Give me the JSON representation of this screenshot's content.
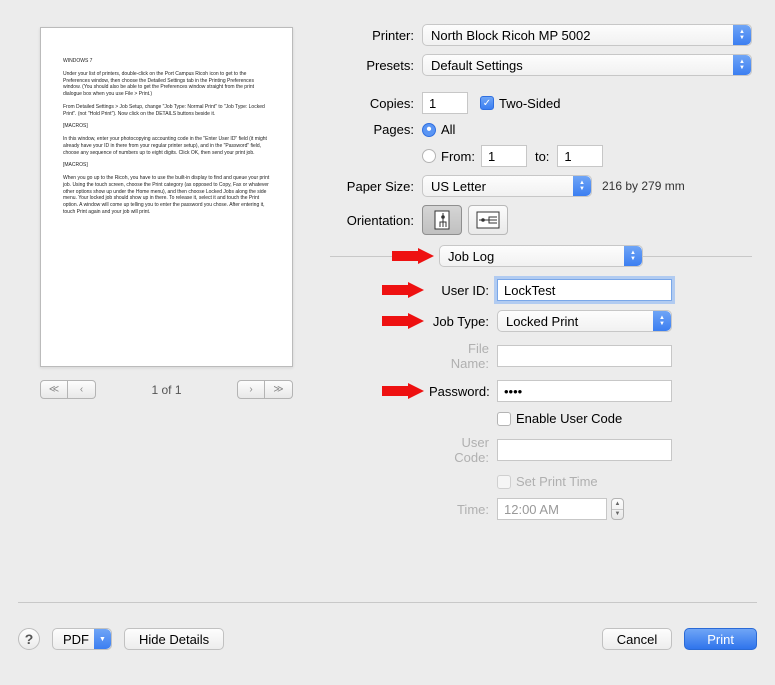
{
  "preview": {
    "page_indicator": "1 of 1",
    "doc": {
      "p1": "WINDOWS 7",
      "p2": "Under your list of printers, double-click on the Port Campus Ricoh icon to get to the Preferences window, then choose the Detailed Settings tab in the Printing Preferences window. (You should also be able to get the Preferences window straight from the print dialogue box when you use File > Print.)",
      "p3": "From Detailed Settings > Job Setup, change \"Job Type: Normal Print\" to \"Job Type: Locked Print\". (not \"Hold Print\"). Now click on the DETAILS buttons beside it.",
      "p4": "[MACROS]",
      "p5": "In this window, enter your photocopying accounting code in the \"Enter User ID\" field (it might already have your ID in there from your regular printer setup), and in the \"Password\" field, choose any sequence of numbers up to eight digits. Click OK, then send your print job.",
      "p6": "[MACROS]",
      "p7": "When you go up to the Ricoh, you have to use the built-in display to find and queue your print job. Using the touch screen, choose the Print category (as opposed to Copy, Fax or whatever other options show up under the Home menu), and then choose Locked Jobs along the side menu. Your locked job should show up in there. To release it, select it and touch the Print option. A window will come up telling you to enter the password you chose. After entering it, touch Print again and your job will print."
    }
  },
  "top": {
    "printer_label": "Printer:",
    "printer_value": "North Block Ricoh MP 5002",
    "presets_label": "Presets:",
    "presets_value": "Default Settings",
    "copies_label": "Copies:",
    "copies_value": "1",
    "twosided_label": "Two-Sided",
    "pages_label": "Pages:",
    "all_label": "All",
    "from_label": "From:",
    "from_value": "1",
    "to_label": "to:",
    "to_value": "1",
    "papersize_label": "Paper Size:",
    "papersize_value": "US Letter",
    "papersize_note": "216 by 279 mm",
    "orientation_label": "Orientation:"
  },
  "section_select": "Job Log",
  "job": {
    "userid_label": "User ID:",
    "userid_value": "LockTest",
    "jobtype_label": "Job Type:",
    "jobtype_value": "Locked Print",
    "filename_label": "File Name:",
    "filename_value": "",
    "password_label": "Password:",
    "password_value": "••••",
    "enable_usercode_label": "Enable User Code",
    "usercode_label": "User Code:",
    "usercode_value": "",
    "set_print_time_label": "Set Print Time",
    "time_label": "Time:",
    "time_value": "12:00 AM"
  },
  "bottom": {
    "pdf_label": "PDF",
    "hide_details_label": "Hide Details",
    "cancel_label": "Cancel",
    "print_label": "Print"
  }
}
